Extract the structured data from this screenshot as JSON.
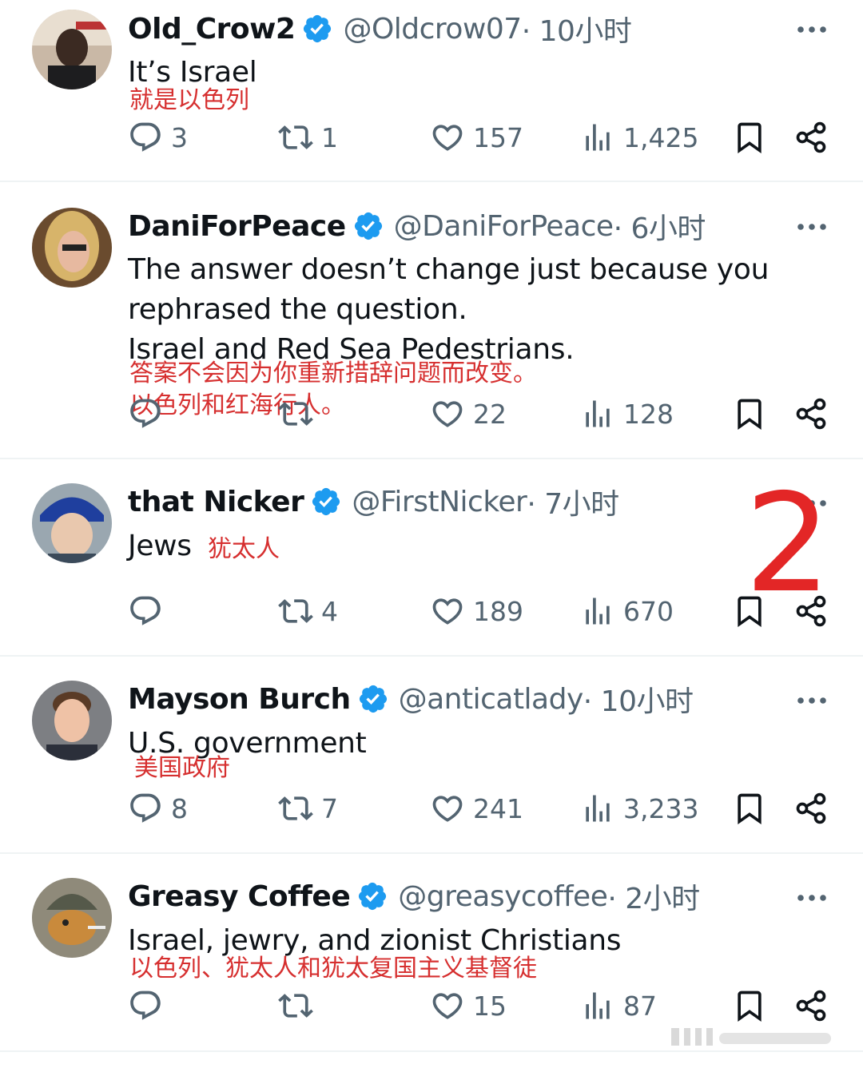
{
  "tweets": [
    {
      "name": "Old_Crow2",
      "handle": "@Oldcrow07",
      "time": " · 10小时",
      "text": "It’s Israel",
      "translation": "就是以色列",
      "replies": "3",
      "reposts": "1",
      "likes": "157",
      "views": "1,425"
    },
    {
      "name": "DaniForPeace",
      "handle": "@DaniForPeace",
      "time": " · 6小时",
      "text": "The answer doesn’t change just because you\nrephrased the question.\nIsrael and Red Sea Pedestrians.",
      "translation": "答案不会因为你重新措辞问题而改变。\n以色列和红海行人。",
      "replies": "",
      "reposts": "",
      "likes": "22",
      "views": "128"
    },
    {
      "name": "that Nicker",
      "handle": "@FirstNicker",
      "time": " · 7小时",
      "text": "Jews",
      "translation": "犹太人",
      "replies": "",
      "reposts": "4",
      "likes": "189",
      "views": "670"
    },
    {
      "name": "Mayson Burch",
      "handle": "@anticatlady",
      "time": " · 10小时",
      "text": "U.S. government",
      "translation": "美国政府",
      "replies": "8",
      "reposts": "7",
      "likes": "241",
      "views": "3,233"
    },
    {
      "name": "Greasy Coffee",
      "handle": "@greasycoffee",
      "time": " · 2小时",
      "text": "Israel, jewry, and zionist Christians",
      "translation": "以色列、犹太人和犹太复国主义基督徒",
      "replies": "",
      "reposts": "",
      "likes": "15",
      "views": "87"
    }
  ],
  "annotation": "2",
  "colors": {
    "verified_badge": "#1d9bf0",
    "icon_gray": "#536471",
    "text_dark": "#0f1419",
    "translation_red": "#d62f2f",
    "divider": "#eff3f4"
  },
  "icons": [
    "reply-icon",
    "repost-icon",
    "like-icon",
    "views-icon",
    "bookmark-icon",
    "share-icon",
    "more-icon",
    "verified-badge-icon"
  ]
}
